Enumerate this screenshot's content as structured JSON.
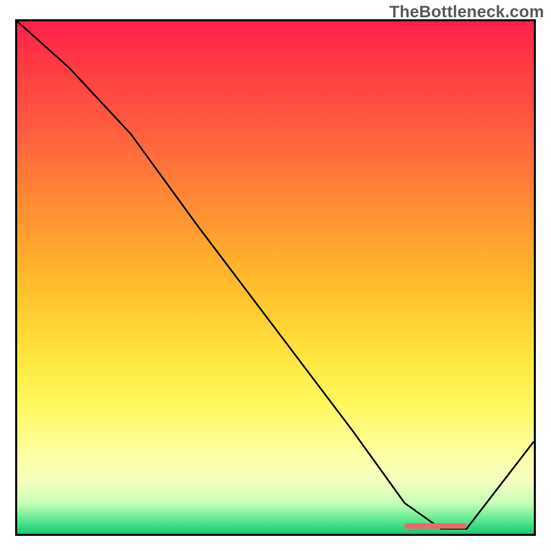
{
  "watermark": "TheBottleneck.com",
  "chart_data": {
    "type": "line",
    "title": "",
    "xlabel": "",
    "ylabel": "",
    "xlim": [
      0,
      100
    ],
    "ylim": [
      0,
      100
    ],
    "grid": false,
    "series": [
      {
        "name": "curve",
        "x": [
          0,
          10,
          22,
          35,
          50,
          65,
          75,
          82,
          87,
          100
        ],
        "y": [
          100,
          91,
          78,
          60,
          40,
          20,
          6,
          1,
          1,
          18
        ]
      }
    ],
    "marker": {
      "x_start": 75,
      "x_end": 87,
      "y": 1.5,
      "color": "#e66a6a"
    },
    "gradient_stops": [
      {
        "pos": 0,
        "color": "#ff1f4a"
      },
      {
        "pos": 0.5,
        "color": "#ffb92a"
      },
      {
        "pos": 0.8,
        "color": "#feff8a"
      },
      {
        "pos": 1.0,
        "color": "#18c872"
      }
    ]
  }
}
